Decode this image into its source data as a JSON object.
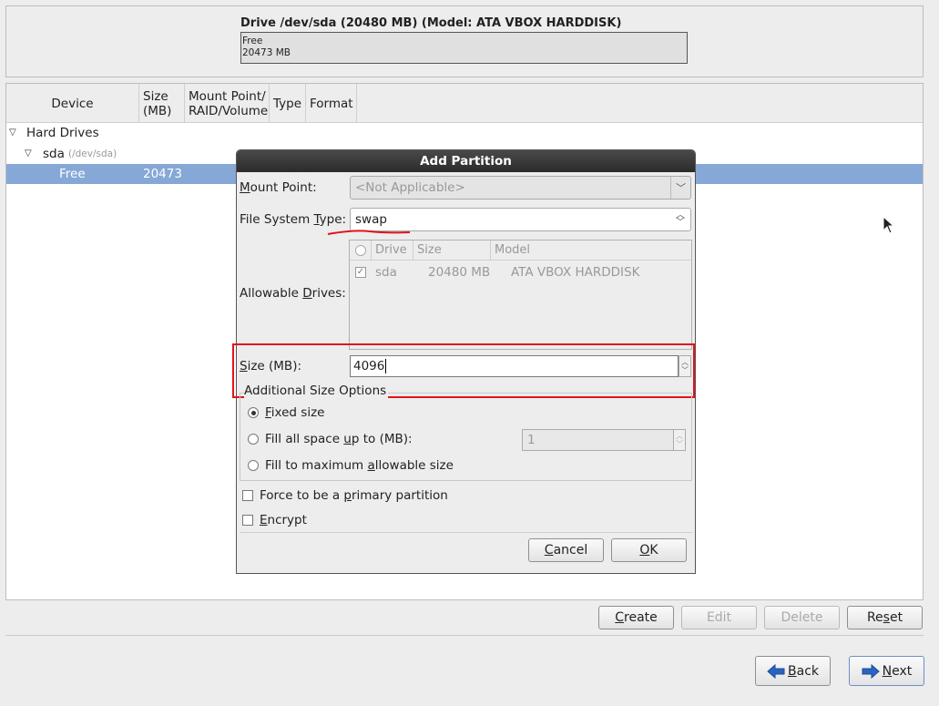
{
  "drive": {
    "title": "Drive /dev/sda (20480 MB) (Model: ATA VBOX HARDDISK)",
    "bar_label": "Free",
    "bar_size": "20473 MB"
  },
  "table": {
    "headers": {
      "device": "Device",
      "size_line1": "Size",
      "size_line2": "(MB)",
      "mount_line1": "Mount Point/",
      "mount_line2": "RAID/Volume",
      "type": "Type",
      "format": "Format"
    },
    "rows": {
      "hard_drives": "Hard Drives",
      "sda": "sda",
      "sda_path": "(/dev/sda)",
      "free": "Free",
      "free_size": "20473"
    }
  },
  "dialog": {
    "title": "Add Partition",
    "mount_point": {
      "label_pre": "",
      "label_u": "M",
      "label_post": "ount Point:",
      "value": "<Not Applicable>"
    },
    "fs_type": {
      "label_pre": "File System ",
      "label_u": "T",
      "label_post": "ype:",
      "value": "swap"
    },
    "allowable": {
      "label_pre": "Allowable ",
      "label_u": "D",
      "label_post": "rives:",
      "headers": {
        "drive": "Drive",
        "size": "Size",
        "model": "Model"
      },
      "row": {
        "drive": "sda",
        "size": "20480 MB",
        "model": "ATA VBOX HARDDISK",
        "checked": true
      }
    },
    "size": {
      "label_pre": "",
      "label_u": "S",
      "label_post": "ize (MB):",
      "value": "4096"
    },
    "additional_title": "Additional Size Options",
    "options": {
      "fixed": {
        "pre": "",
        "u": "F",
        "post": "ixed size",
        "selected": true
      },
      "fill_upto": {
        "pre": "Fill all space ",
        "u": "u",
        "post": "p to (MB):",
        "selected": false,
        "value": "1"
      },
      "fill_max": {
        "pre": "Fill to maximum ",
        "u": "a",
        "post": "llowable size",
        "selected": false
      }
    },
    "primary": {
      "pre": "Force to be a ",
      "u": "p",
      "post": "rimary partition",
      "checked": false
    },
    "encrypt": {
      "pre": "",
      "u": "E",
      "post": "ncrypt",
      "checked": false
    },
    "cancel": {
      "pre": "",
      "u": "C",
      "post": "ancel"
    },
    "ok": {
      "pre": "",
      "u": "O",
      "post": "K"
    }
  },
  "actions": {
    "create": {
      "pre": "",
      "u": "C",
      "post": "reate"
    },
    "edit": "Edit",
    "delete": "Delete",
    "reset": {
      "pre": "Re",
      "u": "s",
      "post": "et"
    }
  },
  "nav": {
    "back": {
      "pre": "",
      "u": "B",
      "post": "ack"
    },
    "next": {
      "pre": "",
      "u": "N",
      "post": "ext"
    }
  },
  "colors": {
    "selection": "#86a8d6",
    "dialog_titlebar": "#2b2b2b",
    "annotation_red": "#e0141a",
    "nav_arrow_blue": "#2a64c0"
  },
  "icons": {
    "expander": "triangle-down-icon",
    "combo": "chevron-down-icon",
    "back": "arrow-left-icon",
    "next": "arrow-right-icon",
    "cursor": "mouse-pointer-icon"
  }
}
